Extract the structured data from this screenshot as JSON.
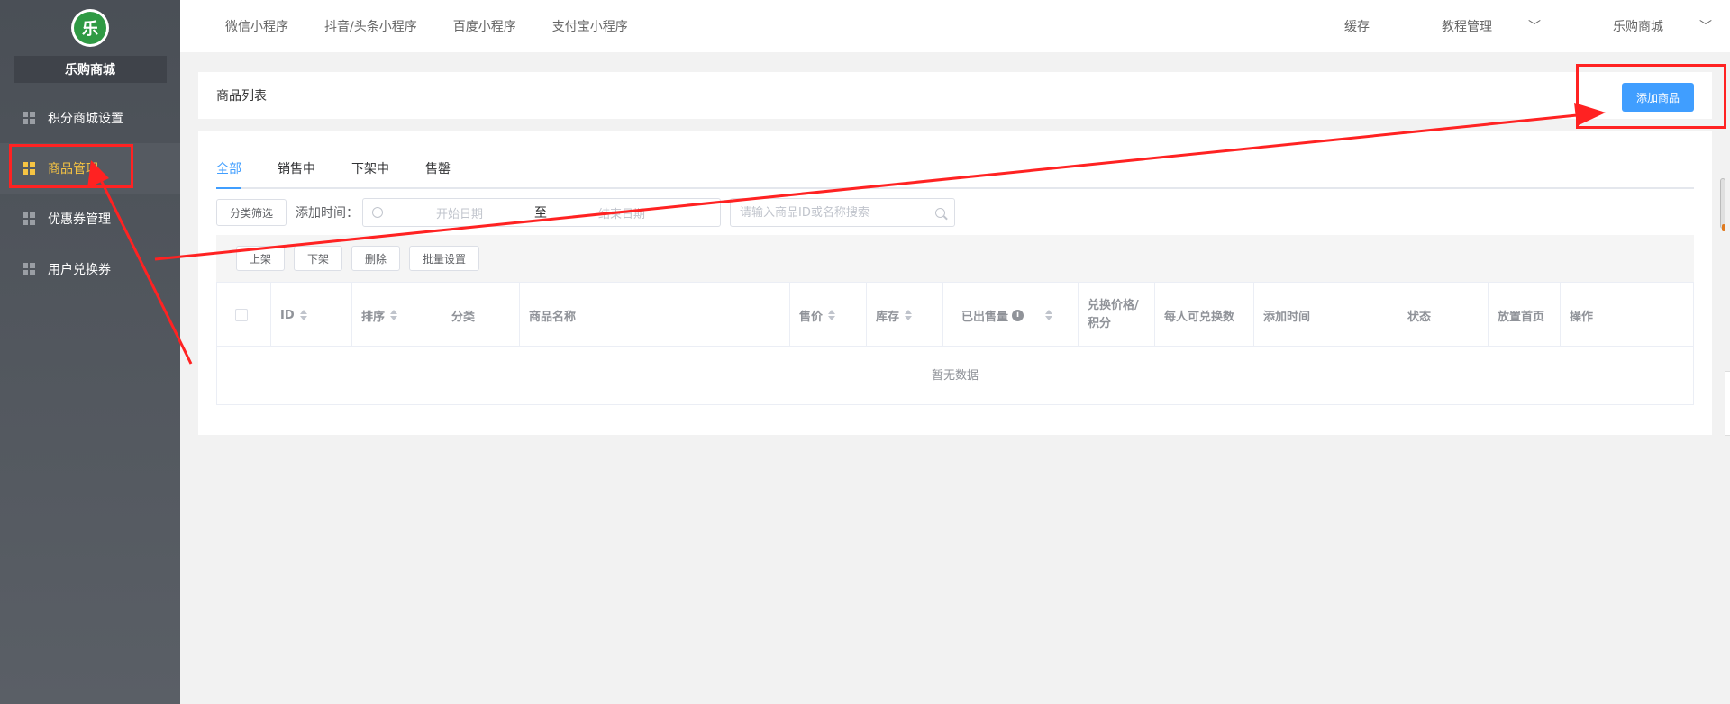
{
  "sidebar": {
    "logo_text": "乐",
    "shop_name": "乐购商城",
    "items": [
      {
        "label": "积分商城设置"
      },
      {
        "label": "商品管理"
      },
      {
        "label": "优惠券管理"
      },
      {
        "label": "用户兑换券"
      }
    ],
    "active_color": "#f6c443"
  },
  "topnav": {
    "tabs": [
      {
        "label": "微信小程序"
      },
      {
        "label": "抖音/头条小程序"
      },
      {
        "label": "百度小程序"
      },
      {
        "label": "支付宝小程序"
      }
    ],
    "right": {
      "cache": "缓存",
      "tutorial": "教程管理",
      "shop": "乐购商城"
    }
  },
  "header": {
    "title": "商品列表",
    "add_button": "添加商品"
  },
  "tabs": [
    {
      "label": "全部"
    },
    {
      "label": "销售中"
    },
    {
      "label": "下架中"
    },
    {
      "label": "售罄"
    }
  ],
  "filters": {
    "category_button": "分类筛选",
    "time_label": "添加时间：",
    "start_placeholder": "开始日期",
    "separator": "至",
    "end_placeholder": "结束日期",
    "search_placeholder": "请输入商品ID或名称搜索"
  },
  "actions": {
    "shelve": "上架",
    "unshelve": "下架",
    "delete": "删除",
    "batch": "批量设置"
  },
  "table": {
    "columns": {
      "id": "ID",
      "sort": "排序",
      "category": "分类",
      "name": "商品名称",
      "price": "售价",
      "stock": "库存",
      "sold": "已出售量",
      "exchange_line1": "兑换价格/",
      "exchange_line2": "积分",
      "per_user": "每人可兑换数",
      "time": "添加时间",
      "status": "状态",
      "home": "放置首页",
      "ops": "操作"
    },
    "empty_text": "暂无数据"
  },
  "colors": {
    "primary": "#409eff",
    "annotation": "#ff2222"
  }
}
